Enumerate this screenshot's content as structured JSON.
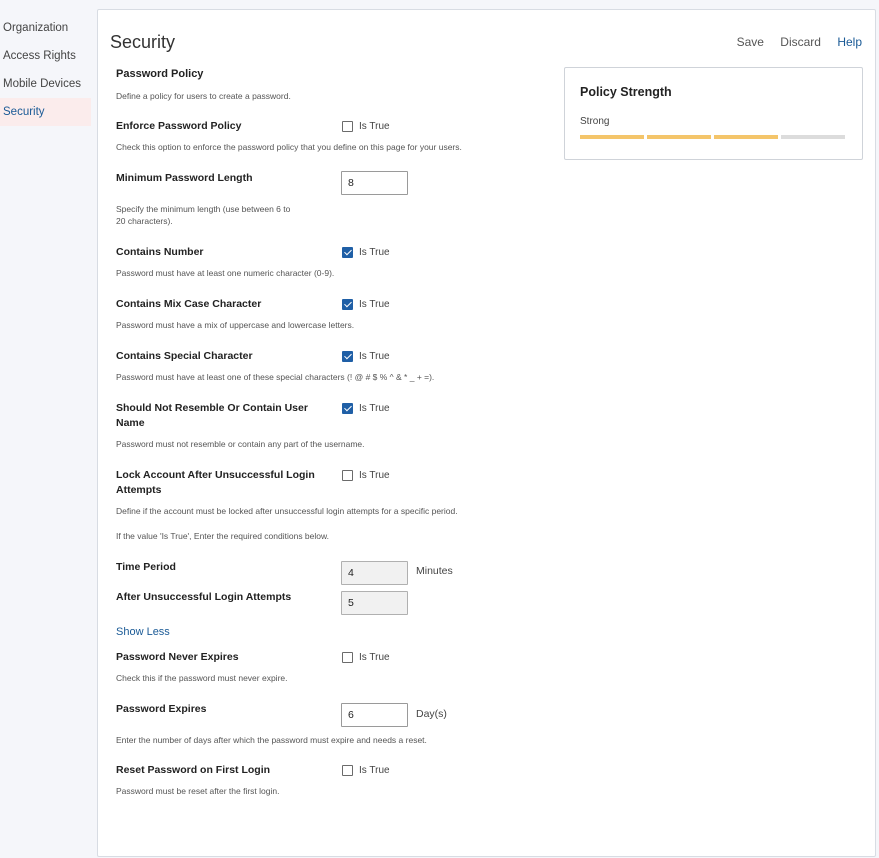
{
  "sidebar": {
    "items": [
      {
        "label": "Organization"
      },
      {
        "label": "Access Rights"
      },
      {
        "label": "Mobile Devices"
      },
      {
        "label": "Security",
        "active": true
      }
    ]
  },
  "header": {
    "title": "Security",
    "save_label": "Save",
    "discard_label": "Discard",
    "help_label": "Help"
  },
  "policy": {
    "section_title": "Password Policy",
    "section_desc": "Define a policy for users to create a password.",
    "is_true_label": "Is True",
    "enforce": {
      "label": "Enforce Password Policy",
      "checked": false,
      "desc": "Check this option to enforce the password policy that you define on this page for your users."
    },
    "min_length": {
      "label": "Minimum Password Length",
      "value": "8",
      "desc_line1": "Specify the minimum length (use between 6 to",
      "desc_line2": "20 characters)."
    },
    "contains_number": {
      "label": "Contains Number",
      "checked": true,
      "desc": "Password must have at least one numeric character (0-9)."
    },
    "mix_case": {
      "label": "Contains Mix Case Character",
      "checked": true,
      "desc": "Password must have a mix of uppercase and lowercase letters."
    },
    "special_char": {
      "label": "Contains Special Character",
      "checked": true,
      "desc": "Password must have at least one of these special characters (! @ # $ % ^ & * _ + =)."
    },
    "not_resemble": {
      "label_line1": "Should Not Resemble Or Contain User",
      "label_line2": "Name",
      "checked": true,
      "desc": "Password must not resemble or contain any part of the username."
    },
    "lock_account": {
      "label_line1": "Lock Account After Unsuccessful Login",
      "label_line2": "Attempts",
      "checked": false,
      "desc": "Define if the account must be locked after unsuccessful login attempts for a specific period.",
      "desc2": "If the value 'Is True', Enter the required conditions below."
    },
    "time_period": {
      "label": "Time Period",
      "value": "4",
      "unit": "Minutes"
    },
    "login_attempts": {
      "label": "After Unsuccessful Login Attempts",
      "value": "5"
    },
    "show_less_label": "Show Less",
    "never_expires": {
      "label": "Password Never Expires",
      "checked": false,
      "desc": "Check this if the password must never expire."
    },
    "expires": {
      "label": "Password Expires",
      "value": "6",
      "unit": "Day(s)",
      "desc": "Enter the number of days after which the password must expire and needs a reset."
    },
    "reset_first_login": {
      "label": "Reset Password on First Login",
      "checked": false,
      "desc": "Password must be reset after the first login."
    }
  },
  "strength": {
    "title": "Policy Strength",
    "value": "Strong",
    "level": 3,
    "max": 4,
    "bar_color": "#f4c56a"
  }
}
